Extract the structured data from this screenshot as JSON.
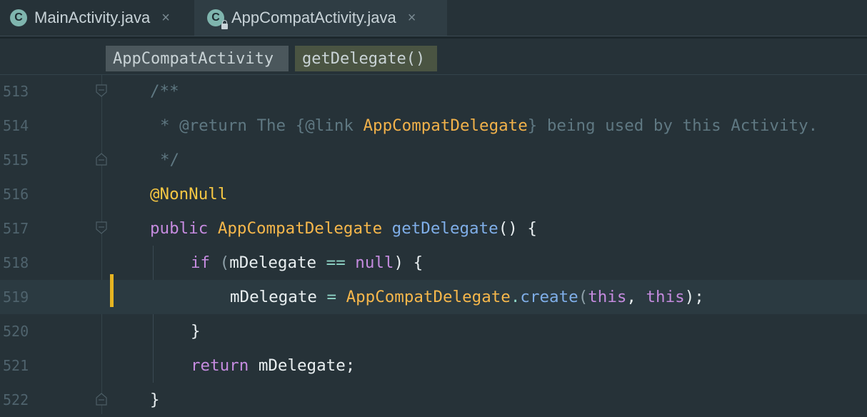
{
  "tabs": [
    {
      "label": "MainActivity.java",
      "icon": "class-c-icon",
      "active": false,
      "close": "×"
    },
    {
      "label": "AppCompatActivity.java",
      "icon": "class-c-locked-icon",
      "active": true,
      "close": "×"
    }
  ],
  "icon_letter": "C",
  "breadcrumb": {
    "class": "AppCompatActivity",
    "method": "getDelegate()"
  },
  "lines": [
    {
      "no": "513",
      "tokens": [
        "/**"
      ]
    },
    {
      "no": "514",
      "tokens": [
        "* @return The {@link ",
        "AppCompatDelegate",
        "} being used by this Activity."
      ]
    },
    {
      "no": "515",
      "tokens": [
        "*/"
      ]
    },
    {
      "no": "516",
      "tokens": [
        "@NonNull"
      ]
    },
    {
      "no": "517",
      "tokens": [
        "public",
        " ",
        "AppCompatDelegate",
        " ",
        "getDelegate",
        "() {"
      ]
    },
    {
      "no": "518",
      "tokens": [
        "if",
        " (",
        "mDelegate",
        " ",
        "==",
        " ",
        "null",
        ") {"
      ]
    },
    {
      "no": "519",
      "tokens": [
        "mDelegate",
        " ",
        "=",
        " ",
        "AppCompatDelegate",
        ".",
        "create",
        "(",
        "this",
        ", ",
        "this",
        ");"
      ]
    },
    {
      "no": "520",
      "tokens": [
        "}"
      ]
    },
    {
      "no": "521",
      "tokens": [
        "return",
        " ",
        "mDelegate",
        ";"
      ]
    },
    {
      "no": "522",
      "tokens": [
        "}"
      ]
    }
  ],
  "colors": {
    "background": "#263238",
    "accent": "#80cbc4",
    "keyword": "#c58bdf",
    "type": "#f6b74b",
    "function": "#7faee8",
    "comment": "#5f7882",
    "change_marker": "#e6b422"
  }
}
